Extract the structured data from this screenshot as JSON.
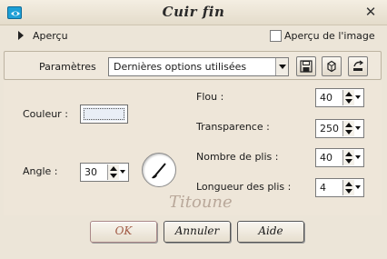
{
  "window": {
    "title": "Cuir fin"
  },
  "preview": {
    "label": "Aperçu",
    "checkbox_label": "Aperçu de l'image",
    "checked": false
  },
  "params": {
    "label": "Paramètres",
    "preset_value": "Dernières options utilisées"
  },
  "fields": {
    "couleur": {
      "label": "Couleur :"
    },
    "angle": {
      "label": "Angle :",
      "value": "30"
    },
    "flou": {
      "label": "Flou :",
      "value": "40"
    },
    "transparence": {
      "label": "Transparence :",
      "value": "250"
    },
    "plis": {
      "label": "Nombre de plis :",
      "value": "40"
    },
    "longueur": {
      "label": "Longueur des plis :",
      "value": "4"
    }
  },
  "watermark": "Titoune",
  "buttons": {
    "ok": "OK",
    "cancel": "Annuler",
    "help": "Aide"
  },
  "icons": [
    "app-icon",
    "close-icon",
    "save-preset-icon",
    "delete-preset-icon",
    "reset-icon",
    "angle-dial-icon"
  ]
}
